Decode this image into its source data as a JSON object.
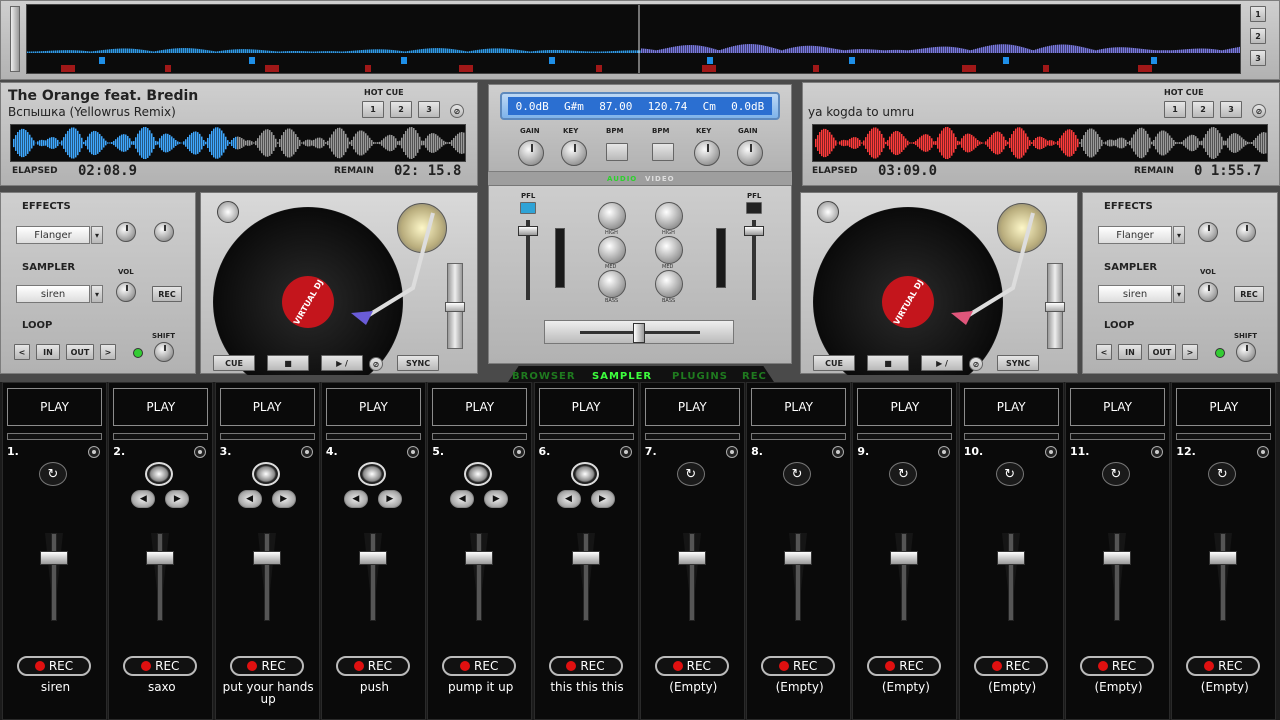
{
  "overview": {
    "buttons": [
      "1",
      "2",
      "3"
    ]
  },
  "left_deck": {
    "artist": "The Orange feat. Bredin",
    "title": "Вспышка (Yellowrus Remix)",
    "hot_cue_label": "HOT CUE",
    "hot_cues": [
      "1",
      "2",
      "3"
    ],
    "elapsed_label": "ELAPSED",
    "elapsed": "02:08.9",
    "remain_label": "REMAIN",
    "remain": "02: 15.8",
    "wave_color": "#3fa8ff",
    "label_text": "VIRTUAL DJ"
  },
  "right_deck": {
    "title": "ya kogda to umru",
    "hot_cue_label": "HOT CUE",
    "hot_cues": [
      "1",
      "2",
      "3"
    ],
    "elapsed_label": "ELAPSED",
    "elapsed": "03:09.0",
    "remain_label": "REMAIN",
    "remain": "0 1:55.7",
    "wave_color": "#ff3b3b",
    "label_text": "VIRTUAL DJ"
  },
  "mixer": {
    "display": [
      "0.0dB",
      "G#m",
      "87.00",
      "120.74",
      "Cm",
      "0.0dB"
    ],
    "top_labels": [
      "GAIN",
      "KEY",
      "BPM",
      "BPM",
      "KEY",
      "GAIN"
    ],
    "audio_tab": "AUDIO",
    "video_tab": "VIDEO",
    "pfl": "PFL",
    "eq": [
      "HIGH",
      "MED",
      "BASS"
    ]
  },
  "left_effects": {
    "effects_label": "EFFECTS",
    "effect": "Flanger",
    "sampler_label": "SAMPLER",
    "sample": "siren",
    "vol_label": "VOL",
    "rec": "REC",
    "loop_label": "LOOP",
    "loop_buttons": [
      "<",
      "IN",
      "OUT",
      ">"
    ],
    "shift_label": "SHIFT"
  },
  "right_effects": {
    "effects_label": "EFFECTS",
    "effect": "Flanger",
    "sampler_label": "SAMPLER",
    "sample": "siren",
    "vol_label": "VOL",
    "rec": "REC",
    "loop_label": "LOOP",
    "loop_buttons": [
      "<",
      "IN",
      "OUT",
      ">"
    ],
    "shift_label": "SHIFT"
  },
  "transport": {
    "cue": "CUE",
    "stop": "■",
    "play": "▶ /",
    "sync": "SYNC"
  },
  "tabs": [
    {
      "label": "BROWSER",
      "active": false
    },
    {
      "label": "SAMPLER",
      "active": true
    },
    {
      "label": "PLUGINS",
      "active": false
    },
    {
      "label": "REC",
      "active": false
    }
  ],
  "samplers": [
    {
      "num": "1.",
      "name": "siren",
      "play": "PLAY",
      "rec": "REC",
      "loaded": false
    },
    {
      "num": "2.",
      "name": "saxo",
      "play": "PLAY",
      "rec": "REC",
      "loaded": true
    },
    {
      "num": "3.",
      "name": "put your hands up",
      "play": "PLAY",
      "rec": "REC",
      "loaded": true
    },
    {
      "num": "4.",
      "name": "push",
      "play": "PLAY",
      "rec": "REC",
      "loaded": true
    },
    {
      "num": "5.",
      "name": "pump it up",
      "play": "PLAY",
      "rec": "REC",
      "loaded": true
    },
    {
      "num": "6.",
      "name": "this this this",
      "play": "PLAY",
      "rec": "REC",
      "loaded": true
    },
    {
      "num": "7.",
      "name": "(Empty)",
      "play": "PLAY",
      "rec": "REC",
      "loaded": false
    },
    {
      "num": "8.",
      "name": "(Empty)",
      "play": "PLAY",
      "rec": "REC",
      "loaded": false
    },
    {
      "num": "9.",
      "name": "(Empty)",
      "play": "PLAY",
      "rec": "REC",
      "loaded": false
    },
    {
      "num": "10.",
      "name": "(Empty)",
      "play": "PLAY",
      "rec": "REC",
      "loaded": false
    },
    {
      "num": "11.",
      "name": "(Empty)",
      "play": "PLAY",
      "rec": "REC",
      "loaded": false
    },
    {
      "num": "12.",
      "name": "(Empty)",
      "play": "PLAY",
      "rec": "REC",
      "loaded": false
    }
  ]
}
